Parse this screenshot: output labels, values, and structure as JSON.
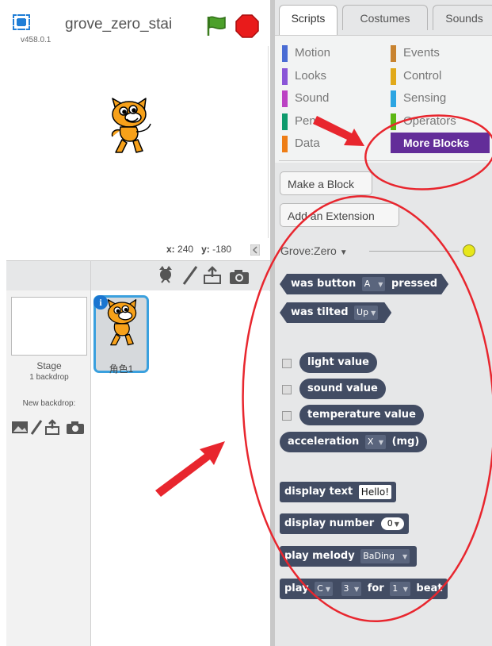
{
  "header": {
    "version": "v458.0.1",
    "project_title": "grove_zero_stai"
  },
  "stage": {
    "x_label": "x:",
    "x_value": "240",
    "y_label": "y:",
    "y_value": "-180"
  },
  "sprites": {
    "stage_label": "Stage",
    "backdrop_count": "1 backdrop",
    "new_backdrop_label": "New backdrop:",
    "sprite_name": "角色1",
    "info_badge": "i"
  },
  "tabs": [
    "Scripts",
    "Costumes",
    "Sounds"
  ],
  "categories": {
    "left": [
      {
        "label": "Motion",
        "color": "#4a6cd4"
      },
      {
        "label": "Looks",
        "color": "#8a55d7"
      },
      {
        "label": "Sound",
        "color": "#bb42c3"
      },
      {
        "label": "Pen",
        "color": "#0e9a6c"
      },
      {
        "label": "Data",
        "color": "#ee7d16"
      }
    ],
    "right": [
      {
        "label": "Events",
        "color": "#c88330"
      },
      {
        "label": "Control",
        "color": "#e1a91a"
      },
      {
        "label": "Sensing",
        "color": "#2ca5e2"
      },
      {
        "label": "Operators",
        "color": "#5cb712"
      },
      {
        "label": "More Blocks",
        "color": "#632d99"
      }
    ]
  },
  "palette_buttons": {
    "make_block": "Make a Block",
    "add_extension": "Add an Extension"
  },
  "extension": {
    "title": "Grove:Zero",
    "dropdown_arrow": "▼",
    "status_color": "#e7e71b"
  },
  "blocks": {
    "was_button_pre": "was button",
    "was_button_field": "A",
    "was_button_post": "pressed",
    "was_tilted_pre": "was tilted",
    "was_tilted_field": "Up",
    "light": "light value",
    "sound": "sound value",
    "temperature": "temperature value",
    "accel_pre": "acceleration",
    "accel_field": "X",
    "accel_post": "(mg)",
    "display_text_pre": "display text",
    "display_text_value": "Hello!",
    "display_number_pre": "display number",
    "display_number_value": "0",
    "play_melody_pre": "play melody",
    "play_melody_field": "BaDing",
    "play_pre": "play",
    "play_note": "C",
    "play_octave": "3",
    "play_for": "for",
    "play_beats": "1",
    "play_post": "beat"
  },
  "colors": {
    "block": "#424c63",
    "annotation": "#e8262e",
    "selected_tab_border": "#3aa0de"
  }
}
